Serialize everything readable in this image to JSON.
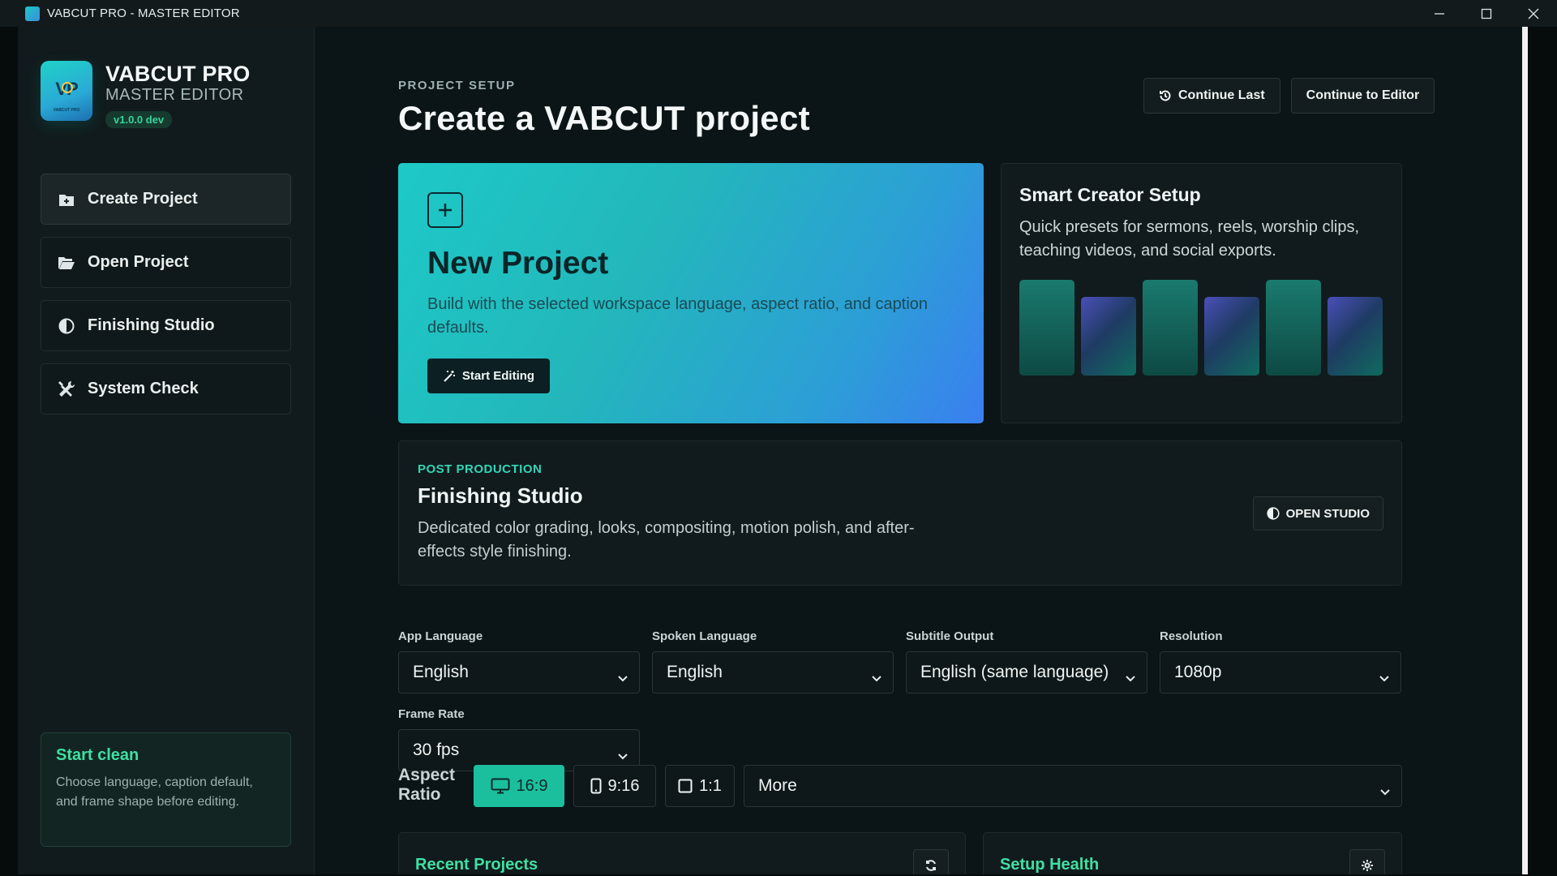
{
  "window": {
    "title": "VABCUT PRO - MASTER EDITOR",
    "minimize": "—",
    "maximize": "☐",
    "close": "✕"
  },
  "brand": {
    "logo_text": "VP",
    "logo_small": "VABCUT PRO",
    "name": "VABCUT PRO",
    "subtitle": "MASTER EDITOR",
    "version": "v1.0.0 dev"
  },
  "sidebar": {
    "items": [
      {
        "label": "Create Project",
        "icon": "add-box-icon",
        "active": true
      },
      {
        "label": "Open Project",
        "icon": "folder-open-icon",
        "active": false
      },
      {
        "label": "Finishing Studio",
        "icon": "half-circle-icon",
        "active": false
      },
      {
        "label": "System Check",
        "icon": "tools-icon",
        "active": false
      }
    ],
    "start_clean": {
      "title": "Start clean",
      "text": "Choose language, caption default, and frame shape before editing."
    }
  },
  "header": {
    "eyebrow": "PROJECT SETUP",
    "title": "Create a VABCUT project",
    "continue_last": "Continue Last",
    "continue_editor": "Continue to Editor"
  },
  "new_project": {
    "title": "New Project",
    "description": "Build with the selected workspace language, aspect ratio, and caption defaults.",
    "button": "Start Editing"
  },
  "smart_setup": {
    "title": "Smart Creator Setup",
    "description": "Quick presets for sermons, reels, worship clips, teaching videos, and social exports."
  },
  "finishing": {
    "kicker": "POST PRODUCTION",
    "title": "Finishing Studio",
    "description": "Dedicated color grading, looks, compositing, motion polish, and after-effects style finishing.",
    "button": "OPEN STUDIO"
  },
  "settings": {
    "app_language": {
      "label": "App Language",
      "value": "English"
    },
    "spoken_language": {
      "label": "Spoken Language",
      "value": "English"
    },
    "subtitle_output": {
      "label": "Subtitle Output",
      "value": "English (same language)"
    },
    "resolution": {
      "label": "Resolution",
      "value": "1080p"
    },
    "frame_rate": {
      "label": "Frame Rate",
      "value": "30 fps"
    }
  },
  "aspect": {
    "label": "Aspect Ratio",
    "options": [
      "16:9",
      "9:16",
      "1:1"
    ],
    "selected": "16:9",
    "more": "More"
  },
  "panels": {
    "recent": "Recent Projects",
    "health": "Setup Health"
  },
  "colors": {
    "accent": "#1bbf9e",
    "accent_text": "#3fe0a3",
    "background": "#0b1416"
  }
}
